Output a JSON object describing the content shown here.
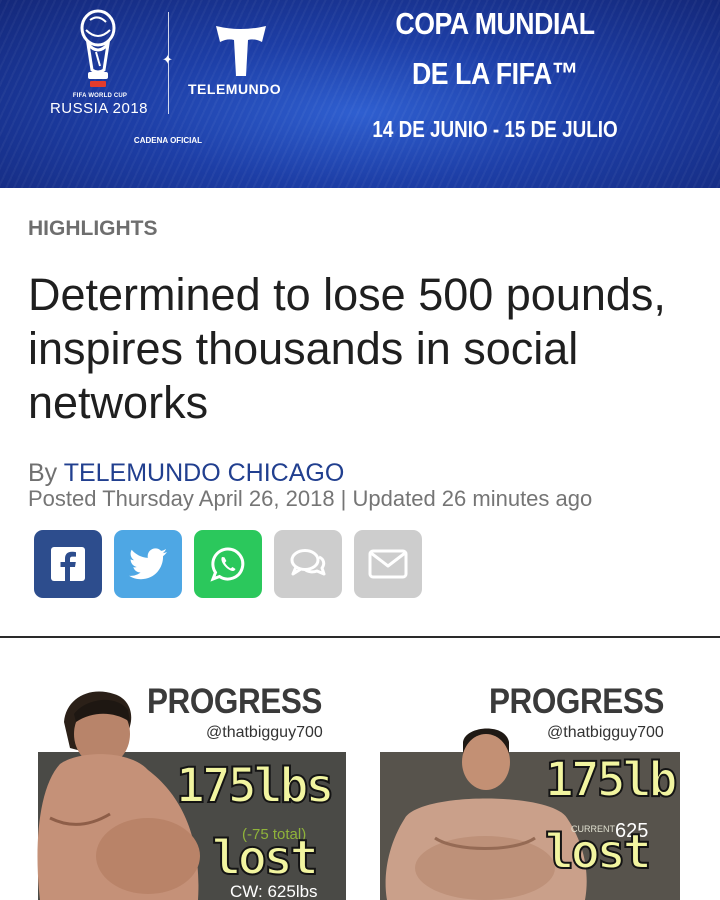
{
  "banner": {
    "wc_small": "FIFA WORLD CUP",
    "wc_big": "RUSSIA 2018",
    "network": "TELEMUNDO",
    "cadena": "CADENA OFICIAL",
    "copa_line1": "COPA MUNDIAL",
    "copa_line2": "DE LA FIFA™",
    "dates": "14 DE JUNIO - 15 DE JULIO",
    "bg_color": "#1d3ea6"
  },
  "article": {
    "category": "HIGHLIGHTS",
    "headline": "Determined to lose 500 pounds, inspires thousands in social networks",
    "by_prefix": "By",
    "author": "TELEMUNDO CHICAGO",
    "posted": "Posted Thursday April 26, 2018 | Updated 26 minutes ago"
  },
  "share": {
    "facebook": {
      "icon": "facebook-icon",
      "color": "#2d4d8d"
    },
    "twitter": {
      "icon": "twitter-icon",
      "color": "#4ea7e4"
    },
    "whatsapp": {
      "icon": "whatsapp-icon",
      "color": "#2bc85c"
    },
    "comments": {
      "icon": "comment-icon",
      "color": "#cdcdcd"
    },
    "email": {
      "icon": "email-icon",
      "color": "#cdcdcd"
    }
  },
  "lead_image": {
    "left": {
      "title": "PROGRESS",
      "handle": "@thatbigguy700",
      "weight": "175lbs",
      "weight_unit_line": "lost",
      "subtext": "(-75 total)",
      "cw": "CW: 625lbs"
    },
    "right": {
      "title": "PROGRESS",
      "handle": "@thatbigguy700",
      "weight": "175lb",
      "weight_unit_line": "lost",
      "current": "CURRENT",
      "current_value": "625"
    }
  }
}
